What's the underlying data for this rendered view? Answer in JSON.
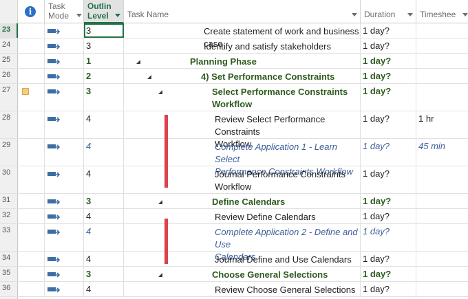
{
  "header": {
    "info_symbol": "i",
    "task_mode": [
      "Task",
      "Mode"
    ],
    "outline_level": [
      "Outlin",
      "Level"
    ],
    "task_name": "Task Name",
    "duration": "Duration",
    "timesheet": "Timeshee"
  },
  "icons": {
    "info": "info-icon",
    "task_mode": "auto-scheduled-task-icon",
    "note": "note-icon",
    "collapse": "collapse-triangle-icon"
  },
  "colors": {
    "summary_text": "#2f5b1f",
    "manual_text": "#3e5f9a",
    "selection": "#217346",
    "marker_bar": "#d9434e"
  },
  "rows": [
    {
      "id": "23",
      "level": "3",
      "name": [
        "Create statement of work and business case"
      ],
      "duration": "1 day?",
      "timesheet": "",
      "style": "normal"
    },
    {
      "id": "24",
      "level": "3",
      "name": [
        "Identify and satisfy stakeholders"
      ],
      "duration": "1 day?",
      "timesheet": "",
      "style": "normal"
    },
    {
      "id": "25",
      "level": "1",
      "name": [
        "Planning Phase"
      ],
      "duration": "1 day?",
      "timesheet": "",
      "style": "summary"
    },
    {
      "id": "26",
      "level": "2",
      "name": [
        "4) Set Performance Constraints"
      ],
      "duration": "1 day?",
      "timesheet": "",
      "style": "summary"
    },
    {
      "id": "27",
      "level": "3",
      "name": [
        "Select Performance Constraints",
        "Workflow"
      ],
      "duration": "1 day?",
      "timesheet": "",
      "style": "summary"
    },
    {
      "id": "28",
      "level": "4",
      "name": [
        "Review Select Performance Constraints",
        "Workflow"
      ],
      "duration": "1 day?",
      "timesheet": "1 hr",
      "style": "normal"
    },
    {
      "id": "29",
      "level": "4",
      "name": [
        "Complete Application 1 - Learn Select",
        "Performance Constraints Workflow"
      ],
      "duration": "1 day?",
      "timesheet": "45 min",
      "style": "manual"
    },
    {
      "id": "30",
      "level": "4",
      "name": [
        "Journal Performance Constraints",
        "Workflow"
      ],
      "duration": "1 day?",
      "timesheet": "",
      "style": "normal"
    },
    {
      "id": "31",
      "level": "3",
      "name": [
        "Define Calendars"
      ],
      "duration": "1 day?",
      "timesheet": "",
      "style": "summary"
    },
    {
      "id": "32",
      "level": "4",
      "name": [
        "Review Define Calendars"
      ],
      "duration": "1 day?",
      "timesheet": "",
      "style": "normal"
    },
    {
      "id": "33",
      "level": "4",
      "name": [
        "Complete Application 2 - Define and Use",
        "Calendars"
      ],
      "duration": "1 day?",
      "timesheet": "",
      "style": "manual"
    },
    {
      "id": "34",
      "level": "4",
      "name": [
        "Journal Define and Use Calendars"
      ],
      "duration": "1 day?",
      "timesheet": "",
      "style": "normal"
    },
    {
      "id": "35",
      "level": "3",
      "name": [
        "Choose General Selections"
      ],
      "duration": "1 day?",
      "timesheet": "",
      "style": "summary"
    },
    {
      "id": "36",
      "level": "4",
      "name": [
        "Review Choose General Selections"
      ],
      "duration": "1 day?",
      "timesheet": "",
      "style": "normal"
    }
  ]
}
